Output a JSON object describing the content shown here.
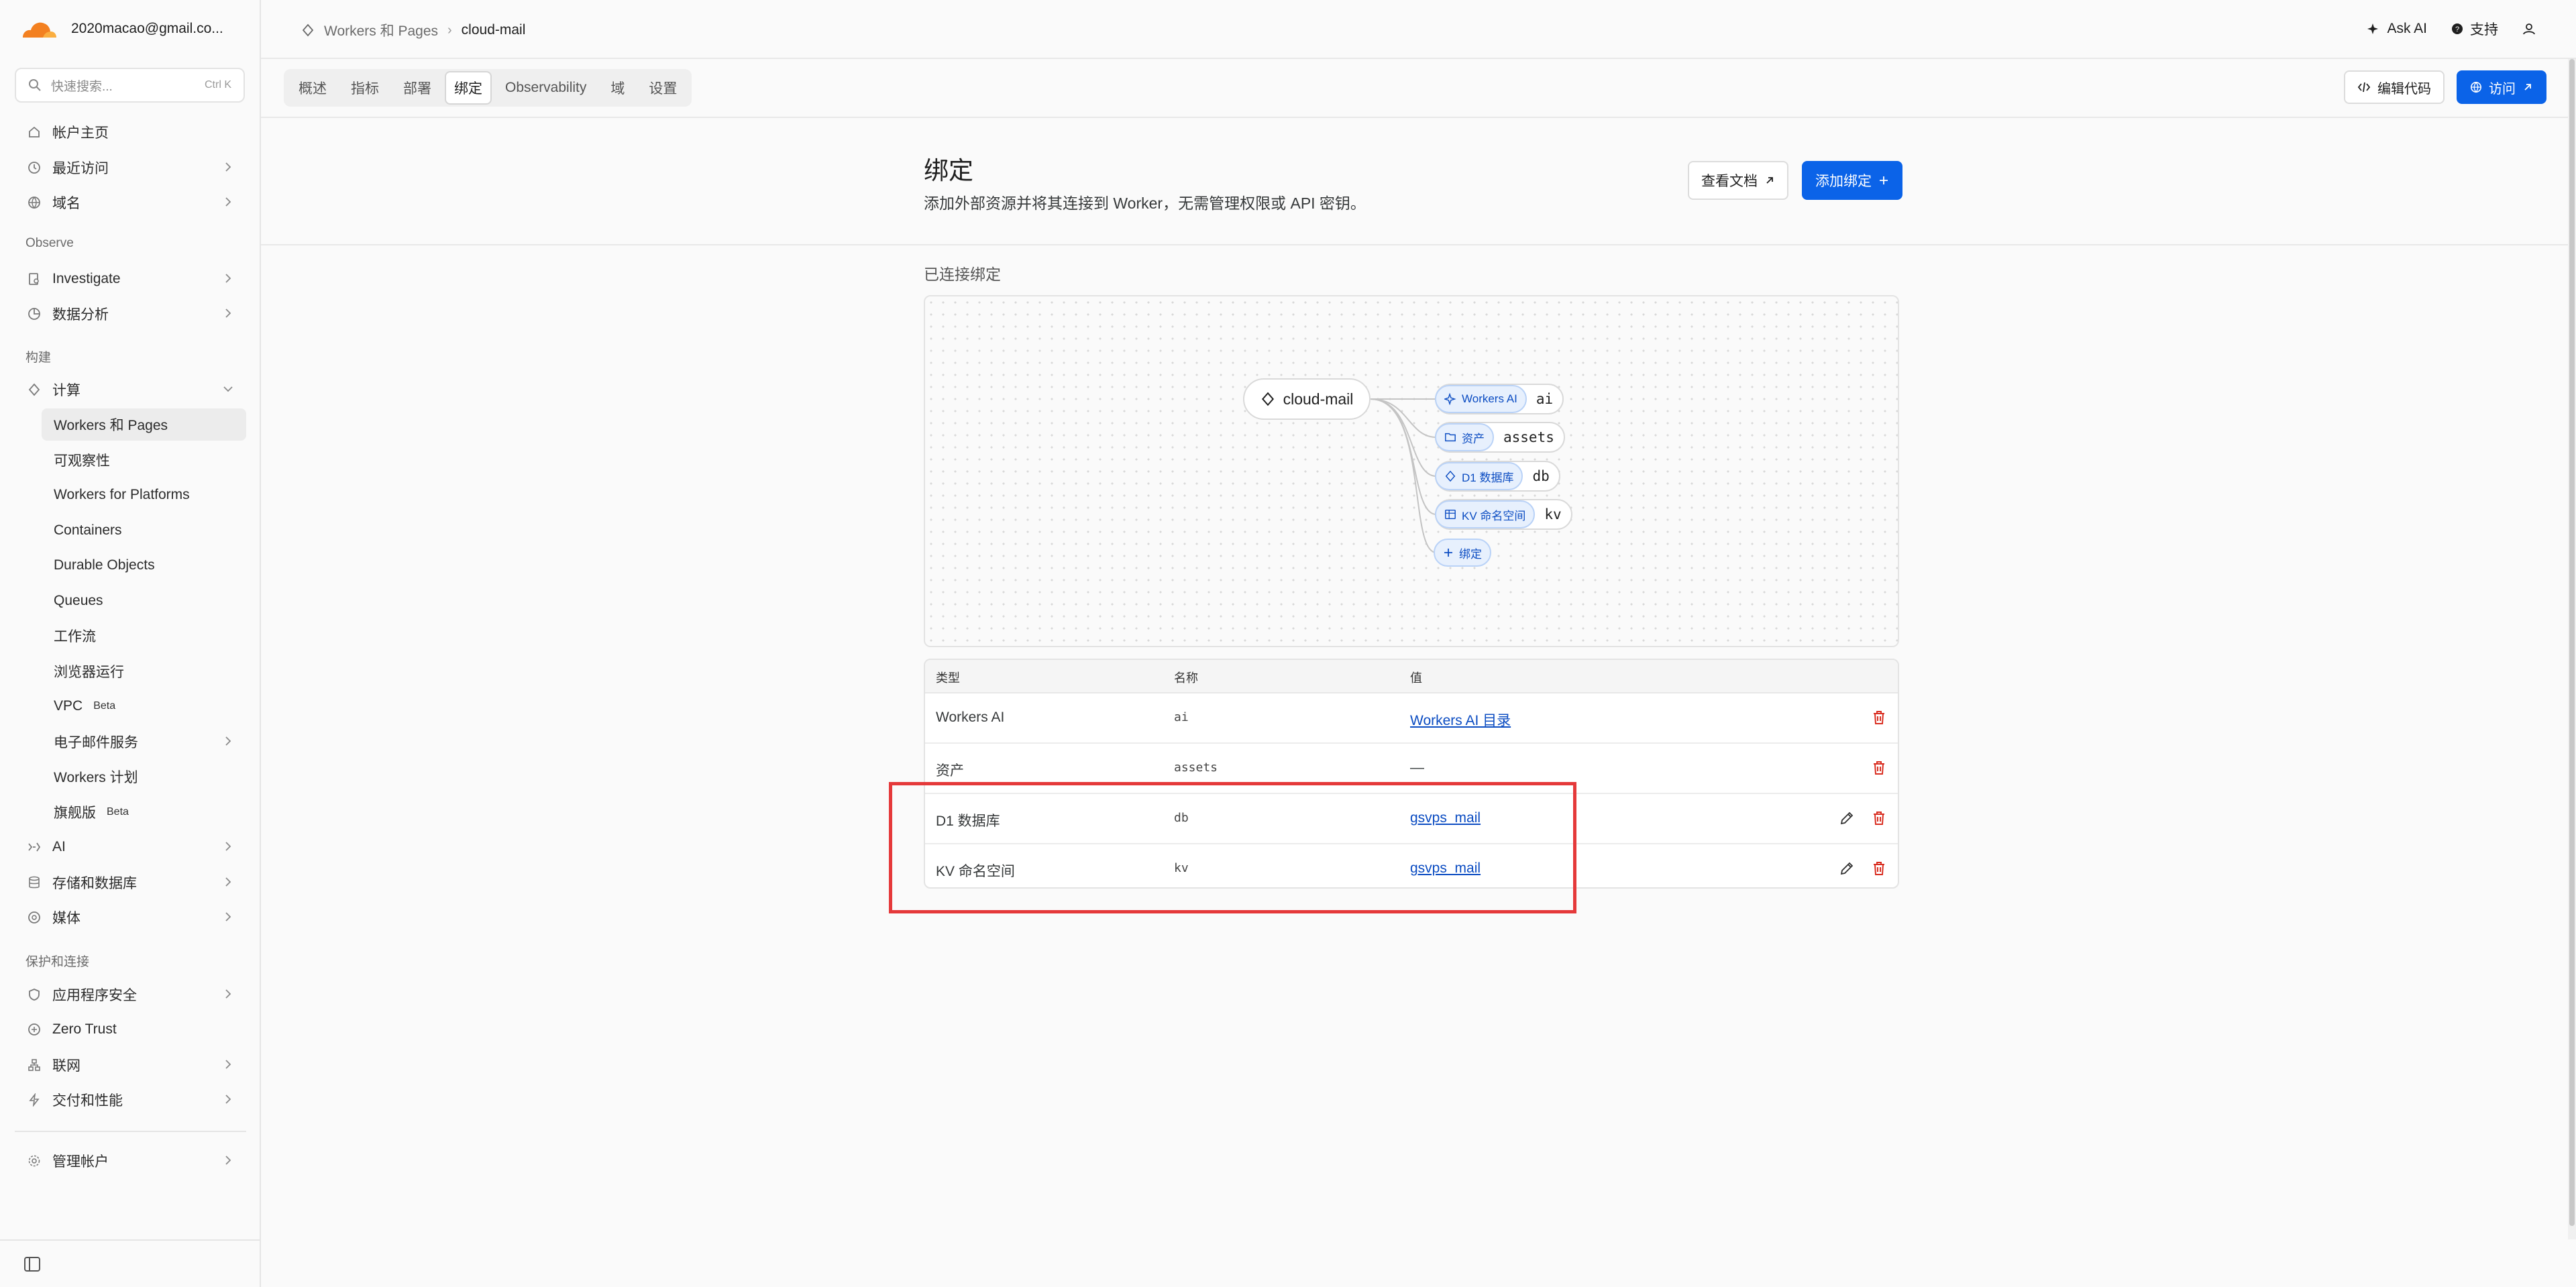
{
  "account": {
    "email": "2020macao@gmail.co..."
  },
  "search": {
    "placeholder": "快速搜索...",
    "shortcut": "Ctrl K"
  },
  "sidebar": {
    "home": "帐户主页",
    "recent": "最近访问",
    "domains": "域名",
    "observe_heading": "Observe",
    "investigate": "Investigate",
    "analytics": "数据分析",
    "build_heading": "构建",
    "compute": "计算",
    "compute_items": [
      "Workers 和 Pages",
      "可观察性",
      "Workers for Platforms",
      "Containers",
      "Durable Objects",
      "Queues",
      "工作流",
      "浏览器运行",
      "VPC",
      "电子邮件服务",
      "Workers 计划",
      "旗舰版"
    ],
    "beta_label": "Beta",
    "ai": "AI",
    "storage": "存储和数据库",
    "media": "媒体",
    "protect_heading": "保护和连接",
    "app_security": "应用程序安全",
    "zero_trust": "Zero Trust",
    "network": "联网",
    "delivery": "交付和性能",
    "manage_account": "管理帐户"
  },
  "breadcrumb": {
    "parent": "Workers 和 Pages",
    "current": "cloud-mail"
  },
  "topbar": {
    "ask_ai": "Ask AI",
    "support": "支持"
  },
  "tabs": [
    "概述",
    "指标",
    "部署",
    "绑定",
    "Observability",
    "域",
    "设置"
  ],
  "active_tab": "绑定",
  "tab_actions": {
    "edit_code": "编辑代码",
    "visit": "访问"
  },
  "page": {
    "title": "绑定",
    "description": "添加外部资源并将其连接到 Worker，无需管理权限或 API 密钥。",
    "docs_button": "查看文档",
    "add_button": "添加绑定"
  },
  "graph": {
    "section_label": "已连接绑定",
    "worker_name": "cloud-mail",
    "bindings": [
      {
        "type": "Workers AI",
        "name": "ai",
        "icon": "sparkle-icon"
      },
      {
        "type": "资产",
        "name": "assets",
        "icon": "folder-icon"
      },
      {
        "type": "D1 数据库",
        "name": "db",
        "icon": "d1-icon"
      },
      {
        "type": "KV 命名空间",
        "name": "kv",
        "icon": "kv-icon"
      }
    ],
    "add_label": "绑定"
  },
  "table": {
    "headers": {
      "type": "类型",
      "name": "名称",
      "value": "值"
    },
    "rows": [
      {
        "type": "Workers AI",
        "name": "ai",
        "value": "Workers AI 目录",
        "editable": false
      },
      {
        "type": "资产",
        "name": "assets",
        "value": "—",
        "editable": false
      },
      {
        "type": "D1 数据库",
        "name": "db",
        "value": "gsvps_mail",
        "editable": true
      },
      {
        "type": "KV 命名空间",
        "name": "kv",
        "value": "gsvps_mail",
        "editable": true
      }
    ]
  },
  "colors": {
    "accent": "#0b63e8",
    "delete": "#d92d20",
    "highlight": "#e5393a",
    "brand_orange": "#f38020"
  }
}
